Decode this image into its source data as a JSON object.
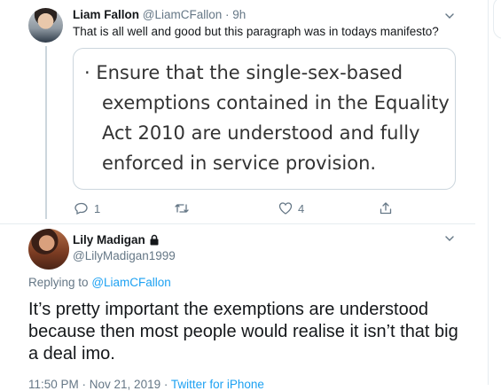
{
  "tweet1": {
    "name": "Liam Fallon",
    "handle": "@LiamCFallon",
    "separator": "·",
    "time": "9h",
    "text": "That is all well and good but this paragraph was in todays manifesto?",
    "quote_line1": "· Ensure that the single-sex-based",
    "quote_line2": "exemptions contained in the Equality",
    "quote_line3": "Act 2010 are understood and fully",
    "quote_line4": "enforced in service provision.",
    "reply_count": "1",
    "like_count": "4"
  },
  "tweet2": {
    "name": "Lily Madigan",
    "handle": "@LilyMadigan1999",
    "replying_prefix": "Replying to",
    "replying_to": "@LiamCFallon",
    "text_line1": "It’s pretty important the exemptions are understood",
    "text_line2": "because then most people would realise it isn’t that big",
    "text_line3": "a deal imo.",
    "timestamp": "11:50 PM · Nov 21, 2019 ·",
    "source": "Twitter for iPhone"
  },
  "colors": {
    "accent": "#1da1f2",
    "muted": "#657786",
    "border": "#ccd6dd"
  },
  "icons": [
    "chevron-down-icon",
    "reply-icon",
    "retweet-icon",
    "like-icon",
    "share-icon",
    "lock-icon"
  ]
}
